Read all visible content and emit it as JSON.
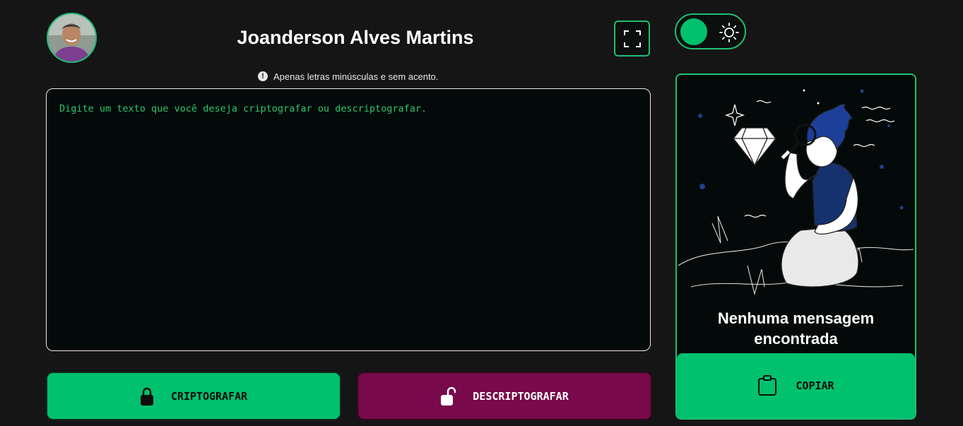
{
  "header": {
    "user_name": "Joanderson Alves Martins",
    "avatar_icon": "user-photo",
    "fullscreen_icon": "expand-icon"
  },
  "hint": {
    "icon": "exclamation-circle-icon",
    "text": "Apenas letras minúsculas e sem acento."
  },
  "editor": {
    "placeholder": "Digite um texto que você deseja criptografar ou descriptografar.",
    "value": ""
  },
  "actions": {
    "encrypt_label": "CRIPTOGRAFAR",
    "encrypt_icon": "lock-icon",
    "decrypt_label": "DESCRIPTOGRAFAR",
    "decrypt_icon": "unlock-icon"
  },
  "theme_toggle": {
    "icon": "sun-icon",
    "state": "dark"
  },
  "output": {
    "empty_message": "Nenhuma mensagem encontrada",
    "copy_label": "COPIAR",
    "copy_icon": "clipboard-icon"
  },
  "colors": {
    "background": "#151515",
    "accent_green": "#00c16e",
    "border_green": "#1fbf73",
    "decrypt_magenta": "#78094a",
    "panel_bg": "#040a09",
    "placeholder_green": "#2ec46f"
  }
}
